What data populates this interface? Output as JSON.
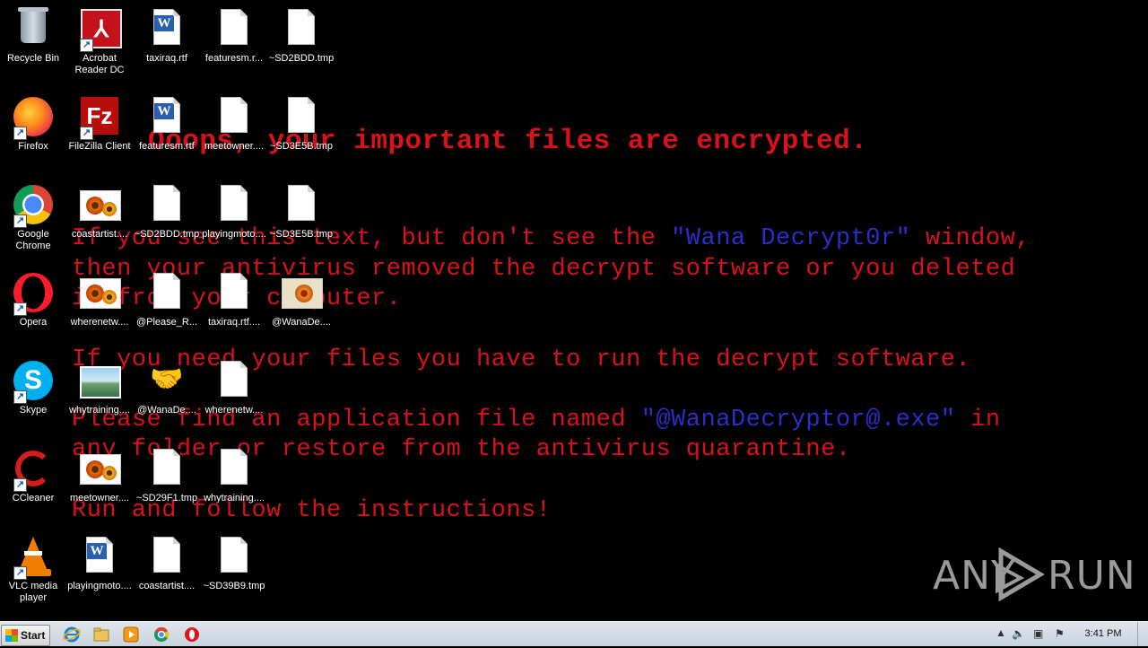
{
  "desktop": {
    "icons": [
      {
        "label": "Recycle Bin",
        "icon": "recycle-bin-icon"
      },
      {
        "label": "Acrobat Reader DC",
        "label_lines": [
          "Acrobat",
          "Reader DC"
        ],
        "icon": "acrobat-reader-icon"
      },
      {
        "label": "taxiraq.rtf",
        "icon": "word-document-icon"
      },
      {
        "label": "featuresm.r...",
        "icon": "blank-file-icon"
      },
      {
        "label": "~SD2BDD.tmp",
        "icon": "blank-file-icon"
      },
      {
        "label": "Firefox",
        "icon": "firefox-icon"
      },
      {
        "label": "FileZilla Client",
        "icon": "filezilla-icon"
      },
      {
        "label": "featuresm.rtf",
        "icon": "word-document-icon"
      },
      {
        "label": "meetowner....",
        "icon": "blank-file-icon"
      },
      {
        "label": "~SD3E5B.tmp",
        "icon": "blank-file-icon"
      },
      {
        "label": "Google Chrome",
        "label_lines": [
          "Google",
          "Chrome"
        ],
        "icon": "chrome-icon"
      },
      {
        "label": "coastartist....",
        "icon": "image-file-icon"
      },
      {
        "label": "~SD2BDD.tmp",
        "icon": "blank-file-icon"
      },
      {
        "label": "playingmoto....",
        "icon": "blank-file-icon"
      },
      {
        "label": "~SD3E5B.tmp",
        "icon": "blank-file-icon"
      },
      {
        "label": "Opera",
        "icon": "opera-icon"
      },
      {
        "label": "wherenetw....",
        "icon": "image-file-icon"
      },
      {
        "label": "@Please_R...",
        "icon": "text-file-icon"
      },
      {
        "label": "taxiraq.rtf....",
        "icon": "blank-file-icon"
      },
      {
        "label": "@WanaDe....",
        "icon": "wanadecryptor-image-icon"
      },
      {
        "label": "Skype",
        "icon": "skype-icon"
      },
      {
        "label": "whytraining....",
        "icon": "landscape-image-icon"
      },
      {
        "label": "@WanaDe....",
        "icon": "handshake-icon"
      },
      {
        "label": "wherenetw....",
        "icon": "blank-file-icon"
      },
      {
        "label": "CCleaner",
        "icon": "ccleaner-icon"
      },
      {
        "label": "meetowner....",
        "icon": "image-file-icon"
      },
      {
        "label": "~SD29F1.tmp",
        "icon": "blank-file-icon"
      },
      {
        "label": "whytraining....",
        "icon": "blank-file-icon"
      },
      {
        "label": "VLC media player",
        "label_lines": [
          "VLC media",
          "player"
        ],
        "icon": "vlc-icon"
      },
      {
        "label": "playingmoto....",
        "icon": "word-document-icon"
      },
      {
        "label": "coastartist....",
        "icon": "blank-file-icon"
      },
      {
        "label": "~SD39B9.tmp",
        "icon": "blank-file-icon"
      }
    ]
  },
  "ransom_note": {
    "title": "Ooops, your important files are encrypted.",
    "para1": [
      {
        "before": "If you see this text, but don't see the ",
        "highlight": "\"Wana Decrypt0r\"",
        "after": " window,"
      },
      {
        "before": "then your antivirus removed the decrypt software or you deleted",
        "highlight": "",
        "after": ""
      },
      {
        "before": "it from your computer.",
        "highlight": "",
        "after": ""
      }
    ],
    "para2": "If you need your files you have to run the decrypt software.",
    "para3": [
      {
        "before": "Please find an application file named ",
        "highlight": "\"@WanaDecryptor@.exe\"",
        "after": " in"
      },
      {
        "before": "any folder or restore from the antivirus quarantine.",
        "highlight": "",
        "after": ""
      }
    ],
    "para4": "Run and follow the instructions!",
    "text_color": "#d8121a",
    "highlight_color": "#2b2fc8"
  },
  "watermark": {
    "left": "ANY",
    "right": "RUN"
  },
  "taskbar": {
    "start_label": "Start",
    "pinned": [
      {
        "icon": "internet-explorer-icon"
      },
      {
        "icon": "folder-icon"
      },
      {
        "icon": "media-player-icon"
      },
      {
        "icon": "chrome-icon"
      },
      {
        "icon": "opera-icon"
      }
    ],
    "clock": "3:41 PM"
  }
}
